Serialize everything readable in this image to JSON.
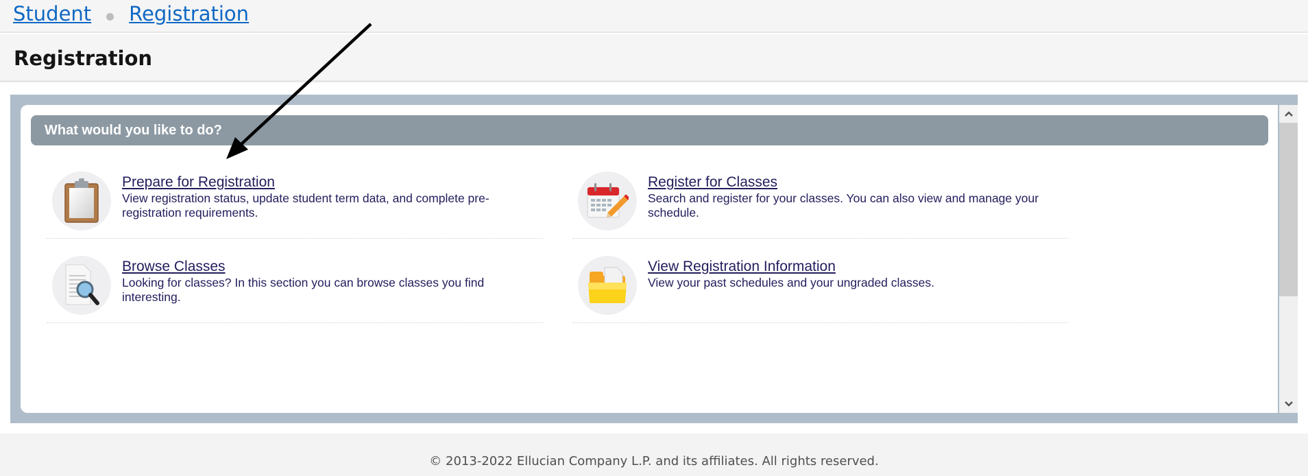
{
  "breadcrumb": {
    "items": [
      {
        "label": "Student"
      },
      {
        "label": "Registration"
      }
    ]
  },
  "page": {
    "title": "Registration"
  },
  "panel": {
    "header": "What would you like to do?",
    "items": [
      {
        "title": "Prepare for Registration",
        "description": "View registration status, update student term data, and complete pre-registration requirements.",
        "icon": "clipboard-icon"
      },
      {
        "title": "Register for Classes",
        "description": "Search and register for your classes. You can also view and manage your schedule.",
        "icon": "calendar-pencil-icon"
      },
      {
        "title": "Browse Classes",
        "description": "Looking for classes? In this section you can browse classes you find interesting.",
        "icon": "document-magnifier-icon"
      },
      {
        "title": "View Registration Information",
        "description": "View your past schedules and your ungraded classes.",
        "icon": "folder-icon"
      }
    ]
  },
  "scrollbar": {
    "up_icon": "chevron-up-icon",
    "down_icon": "chevron-down-icon"
  },
  "footer": {
    "copyright": "© 2013-2022 Ellucian Company L.P. and its affiliates. All rights reserved."
  },
  "annotation": {
    "type": "arrow",
    "points_to": "Prepare for Registration",
    "color": "#000000"
  },
  "colors": {
    "link": "#0f68c4",
    "item_text": "#211d5c",
    "frame": "#afbdca",
    "section_header": "#8c99a3"
  }
}
